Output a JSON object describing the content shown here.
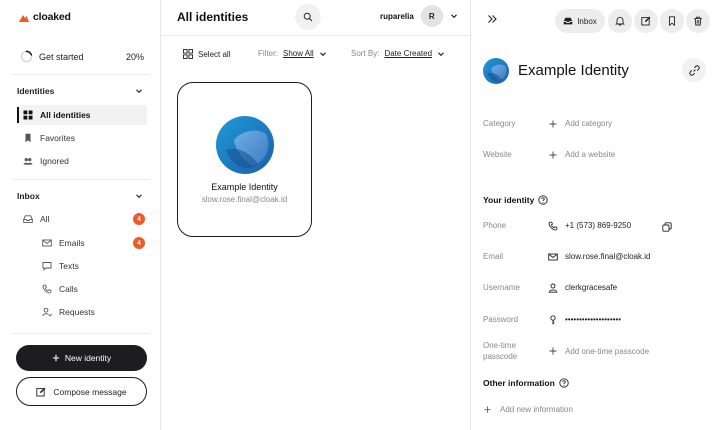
{
  "brand": {
    "name": "cloaked",
    "color": "#f05a28"
  },
  "sidebar": {
    "get_started": {
      "label": "Get started",
      "percent": "20%",
      "progress": 0.2
    },
    "identities_header": "Identities",
    "identities": [
      {
        "label": "All identities",
        "icon": "grid-icon"
      },
      {
        "label": "Favorites",
        "icon": "bookmark-icon"
      },
      {
        "label": "Ignored",
        "icon": "users-icon"
      }
    ],
    "inbox_header": "Inbox",
    "inbox": [
      {
        "label": "All",
        "icon": "inbox-tray-icon",
        "badge": "4"
      },
      {
        "label": "Emails",
        "icon": "mail-icon",
        "badge": "4"
      },
      {
        "label": "Texts",
        "icon": "chat-icon"
      },
      {
        "label": "Calls",
        "icon": "phone-icon"
      },
      {
        "label": "Requests",
        "icon": "user-request-icon"
      }
    ],
    "new_identity": "New identity",
    "compose": "Compose message"
  },
  "main": {
    "title": "All identities",
    "user": {
      "name": "ruparelia",
      "initial": "R"
    },
    "select_all": "Select all",
    "filter_label": "Filter:",
    "filter_value": "Show All",
    "sort_label": "Sort By:",
    "sort_value": "Date Created",
    "card": {
      "name": "Example Identity",
      "email": "slow.rose.final@cloak.id"
    }
  },
  "detail": {
    "inbox_label": "Inbox",
    "title": "Example Identity",
    "category": {
      "key": "Category",
      "value": "Add category"
    },
    "website": {
      "key": "Website",
      "value": "Add a website"
    },
    "your_identity": "Your identity",
    "phone": {
      "key": "Phone",
      "value": "+1 (573) 869-9250"
    },
    "email": {
      "key": "Email",
      "value": "slow.rose.final@cloak.id"
    },
    "username": {
      "key": "Username",
      "value": "clerkgracesafe"
    },
    "password": {
      "key": "Password",
      "value": "••••••••••••••••••••"
    },
    "otp": {
      "key_line1": "One-time",
      "key_line2": "passcode",
      "value": "Add one-time passcode"
    },
    "other_information": "Other information",
    "add_new_information": "Add new information"
  }
}
